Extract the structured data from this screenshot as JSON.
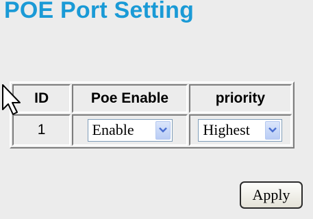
{
  "page": {
    "title": "POE Port Setting"
  },
  "table": {
    "headers": {
      "id": "ID",
      "enable": "Poe Enable",
      "priority": "priority"
    },
    "rows": [
      {
        "id": "1",
        "enable": "Enable",
        "priority": "Highest"
      }
    ]
  },
  "actions": {
    "apply_label": "Apply"
  },
  "icons": {
    "dropdown_arrow": "chevron-down-icon",
    "pointer": "mouse-cursor-icon"
  },
  "colors": {
    "title": "#1a9ad6",
    "background": "#ececec",
    "dropdown_arrow": "#4a6fd1"
  }
}
